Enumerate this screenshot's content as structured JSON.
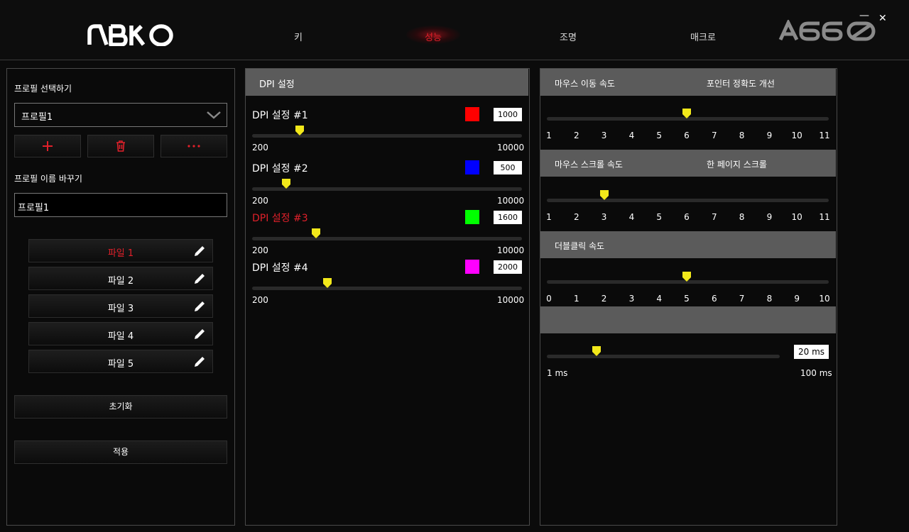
{
  "brand": {
    "logo": "ABKO",
    "model": "A660"
  },
  "nav": [
    {
      "label": "키",
      "active": false
    },
    {
      "label": "성능",
      "active": true
    },
    {
      "label": "조명",
      "active": false
    },
    {
      "label": "매크로",
      "active": false
    }
  ],
  "window": {
    "minimize": "—",
    "close": "✕"
  },
  "profile": {
    "select_label": "프로필 선택하기",
    "selected": "프로필1",
    "rename_label": "프로필 이름 바꾸기",
    "name_value": "프로필1",
    "add_icon": "plus-icon",
    "delete_icon": "trash-icon",
    "more_icon": "more-icon",
    "files": [
      {
        "label": "파일 1",
        "active": true
      },
      {
        "label": "파일 2",
        "active": false
      },
      {
        "label": "파일 3",
        "active": false
      },
      {
        "label": "파일 4",
        "active": false
      },
      {
        "label": "파일 5",
        "active": false
      }
    ],
    "reset_label": "초기화",
    "apply_label": "적용"
  },
  "dpi": {
    "title": "DPI 설정",
    "min": "200",
    "max": "10000",
    "settings": [
      {
        "label": "DPI 설정 #1",
        "color": "#ff0000",
        "value": "1000",
        "active": false
      },
      {
        "label": "DPI 설정 #2",
        "color": "#0000ff",
        "value": "500",
        "active": false
      },
      {
        "label": "DPI 설정 #3",
        "color": "#00ff00",
        "value": "1600",
        "active": true
      },
      {
        "label": "DPI 설정 #4",
        "color": "#ff00ff",
        "value": "2000",
        "active": false
      }
    ]
  },
  "mouse": {
    "speed": {
      "title": "마우스 이동 속도",
      "extra": "포인터 정확도 개선",
      "ticks": [
        "1",
        "2",
        "3",
        "4",
        "5",
        "6",
        "7",
        "8",
        "9",
        "10",
        "11"
      ],
      "value": 6
    },
    "scroll": {
      "title": "마우스 스크롤 속도",
      "extra": "한 페이지 스크롤",
      "ticks": [
        "1",
        "2",
        "3",
        "4",
        "5",
        "6",
        "7",
        "8",
        "9",
        "10",
        "11"
      ],
      "value": 3
    },
    "dblclick": {
      "title": "더블클릭 속도",
      "ticks": [
        "0",
        "1",
        "2",
        "3",
        "4",
        "5",
        "6",
        "7",
        "8",
        "9",
        "10"
      ],
      "value": 5
    },
    "response": {
      "value_text": "20 ms",
      "min": "1 ms",
      "max": "100 ms",
      "fraction": 0.19
    }
  },
  "colors": {
    "accent": "#e0202a",
    "thumb": "#f2e81a",
    "bar": "#5b5b5b"
  }
}
